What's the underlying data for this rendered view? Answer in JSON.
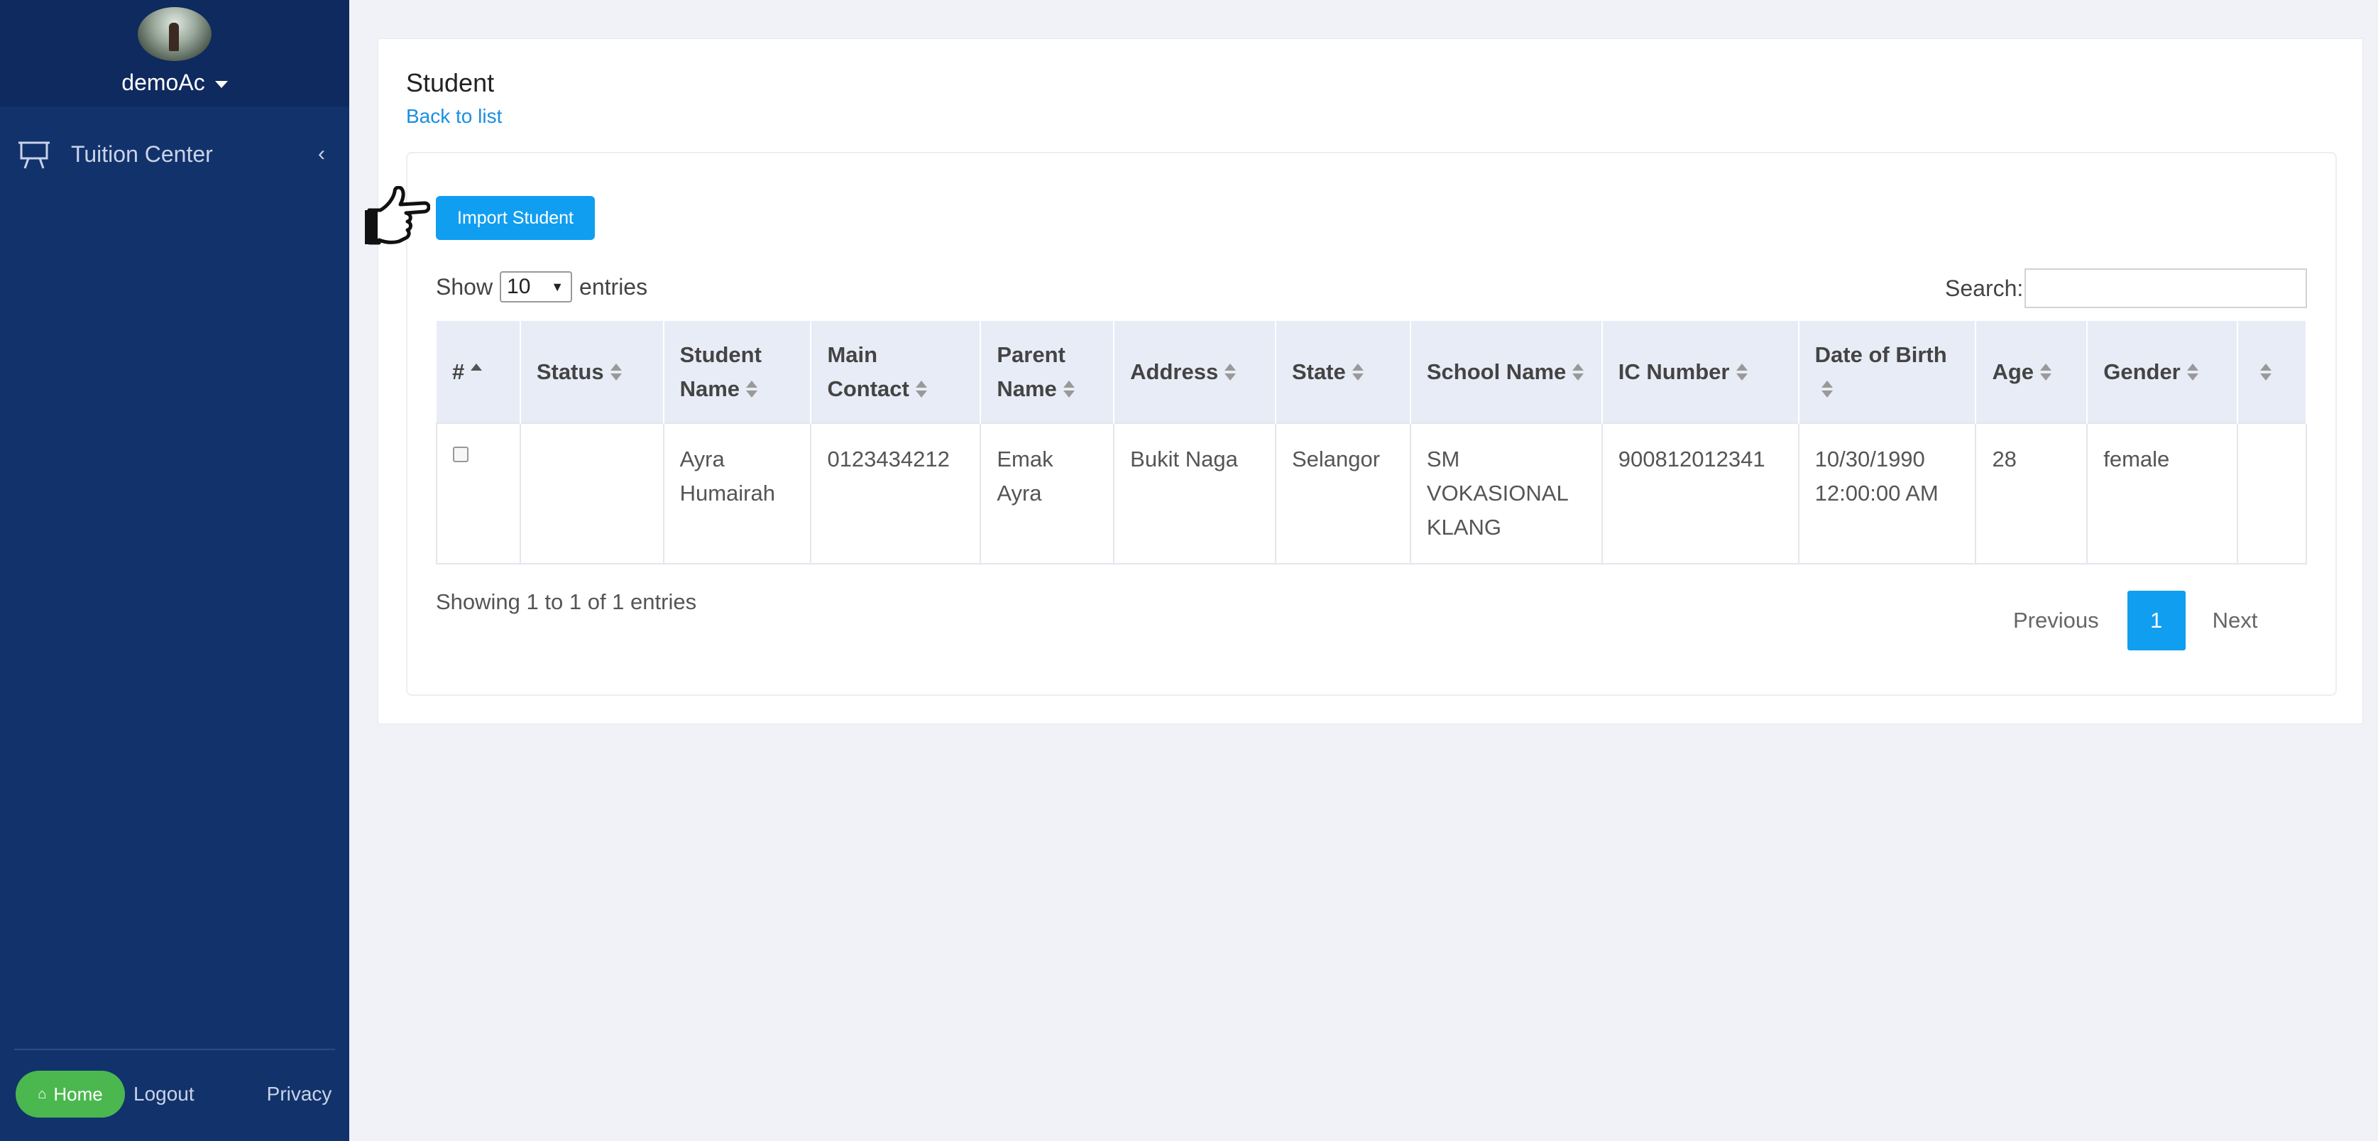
{
  "sidebar": {
    "username": "demoAc",
    "nav_items": [
      {
        "label": "Tuition Center",
        "icon": "presentation-board-icon"
      }
    ],
    "footer": {
      "home_label": "Home",
      "logout_label": "Logout",
      "privacy_label": "Privacy"
    }
  },
  "page": {
    "title": "Student",
    "back_link": "Back to list",
    "import_button": "Import Student"
  },
  "table_controls": {
    "show_label": "Show",
    "page_size": "10",
    "entries_label": "entries",
    "search_label": "Search:",
    "search_value": ""
  },
  "table": {
    "columns": [
      "#",
      "Status",
      "Student Name",
      "Main Contact",
      "Parent Name",
      "Address",
      "State",
      "School Name",
      "IC Number",
      "Date of Birth",
      "Age",
      "Gender",
      ""
    ],
    "rows": [
      {
        "status": "",
        "student_name": "Ayra Humairah",
        "main_contact": "0123434212",
        "parent_name": "Emak Ayra",
        "address": "Bukit Naga",
        "state": "Selangor",
        "school_name": "SM VOKASIONAL KLANG",
        "ic_number": "900812012341",
        "date_of_birth": "10/30/1990 12:00:00 AM",
        "age": "28",
        "gender": "female",
        "extra": ""
      }
    ]
  },
  "pagination": {
    "info": "Showing 1 to 1 of 1 entries",
    "previous": "Previous",
    "current": "1",
    "next": "Next"
  },
  "colors": {
    "sidebar": "#12326b",
    "accent": "#109ef0",
    "home_button": "#4bb84f"
  }
}
